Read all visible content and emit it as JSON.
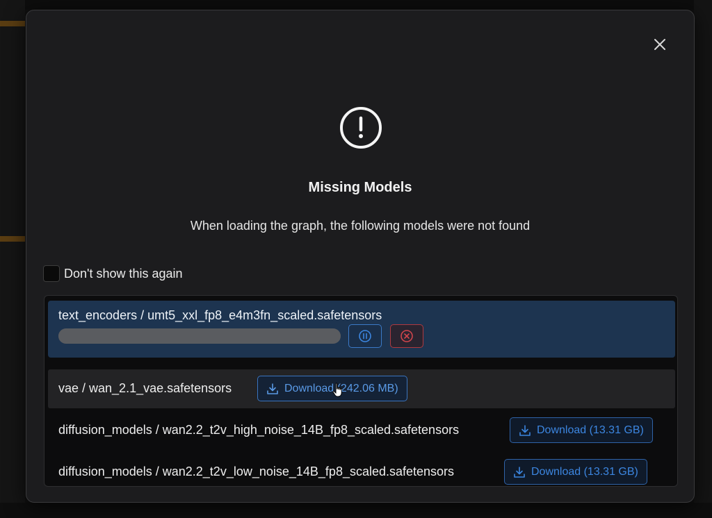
{
  "dialog": {
    "title": "Missing Models",
    "message": "When loading the graph, the following models were not found",
    "close_icon": "close-icon",
    "alert_icon": "exclamation-circle-icon",
    "dont_show_label": "Don't show this again",
    "dont_show_checked": false
  },
  "models": [
    {
      "label": "text_encoders / umt5_xxl_fp8_e4m3fn_scaled.safetensors",
      "state": "downloading",
      "progress": 1.0
    },
    {
      "label": "vae / wan_2.1_vae.safetensors",
      "state": "idle",
      "download_label": "Download (242.06 MB)"
    },
    {
      "label": "diffusion_models / wan2.2_t2v_high_noise_14B_fp8_scaled.safetensors",
      "state": "idle",
      "download_label": "Download (13.31 GB)"
    },
    {
      "label": "diffusion_models / wan2.2_t2v_low_noise_14B_fp8_scaled.safetensors",
      "state": "idle",
      "download_label": "Download (13.31 GB)"
    }
  ],
  "colors": {
    "active_row": "#1d3450",
    "accent_blue": "#3c86e0",
    "cancel_red": "#d0454c"
  }
}
